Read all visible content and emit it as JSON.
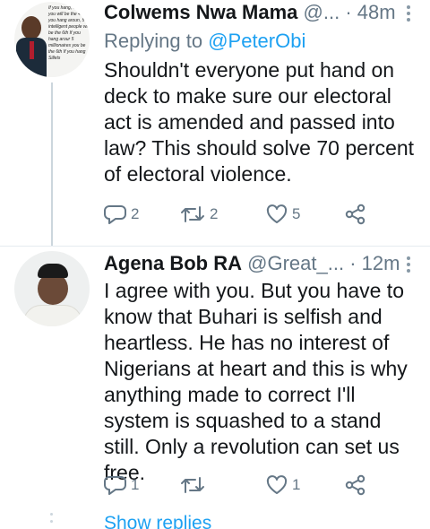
{
  "tweets": [
    {
      "name": "Colwems Nwa Mama",
      "handle": "@...",
      "separator": "·",
      "time": "48m",
      "reply_prefix": "Replying to",
      "reply_handle": "@PeterObi",
      "text": "Shouldn't everyone put hand on deck to make sure our electoral act is amended and passed into law? This should solve 70 percent of electoral violence.",
      "avatar_text": "If you hang, confident you will be the 4h If you hang aroun, 5 intelligent people will be the 6th If you hang arour 5 millionaires you be the 6th If you hang Sillets",
      "actions": {
        "reply_count": "2",
        "retweet_count": "2",
        "like_count": "5"
      }
    },
    {
      "name": "Agena Bob RA",
      "handle": "@Great_...",
      "separator": "·",
      "time": "12m",
      "text": "I agree with you. But you have to know that Buhari is selfish and heartless. He has no interest of Nigerians at heart and this is why anything made to correct I'll system is squashed to a stand still. Only a revolution can set us free.",
      "actions": {
        "reply_count": "1",
        "retweet_count": "",
        "like_count": "1"
      }
    }
  ],
  "show_replies": "Show replies",
  "colors": {
    "link": "#1da1f2",
    "muted": "#657786",
    "text": "#14171a"
  },
  "icons": [
    "reply-icon",
    "retweet-icon",
    "like-icon",
    "share-icon",
    "more-icon"
  ]
}
